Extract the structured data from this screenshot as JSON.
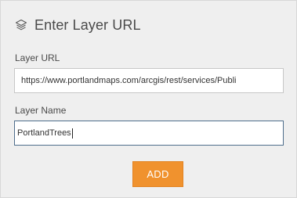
{
  "header": {
    "icon": "layers-icon",
    "title": "Enter Layer URL"
  },
  "form": {
    "url_label": "Layer URL",
    "url_value": "https://www.portlandmaps.com/arcgis/rest/services/Publi",
    "name_label": "Layer Name",
    "name_value": "PortlandTrees"
  },
  "actions": {
    "add_label": "ADD"
  },
  "colors": {
    "panel_bg": "#efefef",
    "accent": "#f0922e",
    "focus_border": "#4f6e8c"
  }
}
